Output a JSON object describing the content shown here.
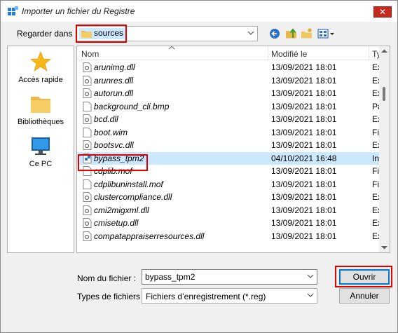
{
  "window": {
    "title": "Importer un fichier du Registre",
    "close_label": "✕"
  },
  "lookin": {
    "label": "Regarder dans :",
    "value": "sources"
  },
  "toolbar": {
    "icons": [
      "back-icon",
      "up-folder-icon",
      "new-folder-icon",
      "view-menu-icon"
    ]
  },
  "places": [
    {
      "label": "Accès rapide",
      "icon": "star-icon"
    },
    {
      "label": "Bibliothèques",
      "icon": "library-icon"
    },
    {
      "label": "Ce PC",
      "icon": "computer-icon"
    }
  ],
  "columns": {
    "name": "Nom",
    "modified": "Modifié le",
    "type": "Ty"
  },
  "files": [
    {
      "name": "arunimg.dll",
      "date": "13/09/2021 18:01",
      "type": "Ex",
      "icon": "dll-file-icon"
    },
    {
      "name": "arunres.dll",
      "date": "13/09/2021 18:01",
      "type": "Ex",
      "icon": "dll-file-icon"
    },
    {
      "name": "autorun.dll",
      "date": "13/09/2021 18:01",
      "type": "Ex",
      "icon": "dll-file-icon"
    },
    {
      "name": "background_cli.bmp",
      "date": "13/09/2021 18:01",
      "type": "Pa",
      "icon": "file-icon"
    },
    {
      "name": "bcd.dll",
      "date": "13/09/2021 18:01",
      "type": "Ex",
      "icon": "dll-file-icon"
    },
    {
      "name": "boot.wim",
      "date": "13/09/2021 18:01",
      "type": "Fic",
      "icon": "file-icon"
    },
    {
      "name": "bootsvc.dll",
      "date": "13/09/2021 18:01",
      "type": "Ex",
      "icon": "dll-file-icon"
    },
    {
      "name": "bypass_tpm2",
      "date": "04/10/2021 16:48",
      "type": "Ins",
      "icon": "reg-file-icon",
      "selected": true
    },
    {
      "name": "cdplib.mof",
      "date": "13/09/2021 18:01",
      "type": "Fic",
      "icon": "file-icon"
    },
    {
      "name": "cdplibuninstall.mof",
      "date": "13/09/2021 18:01",
      "type": "Fic",
      "icon": "file-icon"
    },
    {
      "name": "clustercompliance.dll",
      "date": "13/09/2021 18:01",
      "type": "Ex",
      "icon": "dll-file-icon"
    },
    {
      "name": "cmi2migxml.dll",
      "date": "13/09/2021 18:01",
      "type": "Ex",
      "icon": "dll-file-icon"
    },
    {
      "name": "cmisetup.dll",
      "date": "13/09/2021 18:01",
      "type": "Ex",
      "icon": "dll-file-icon"
    },
    {
      "name": "compatappraiserresources.dll",
      "date": "13/09/2021 18:01",
      "type": "Ex",
      "icon": "dll-file-icon"
    }
  ],
  "filename": {
    "label": "Nom du fichier :",
    "value": "bypass_tpm2"
  },
  "filetype": {
    "label": "Types de fichiers :",
    "value": "Fichiers d’enregistrement (*.reg)"
  },
  "buttons": {
    "open": "Ouvrir",
    "cancel": "Annuler"
  },
  "colors": {
    "highlight_red": "#e10000",
    "selection": "#cce8ff",
    "accent": "#0078d7",
    "close_red": "#c42b1c"
  }
}
